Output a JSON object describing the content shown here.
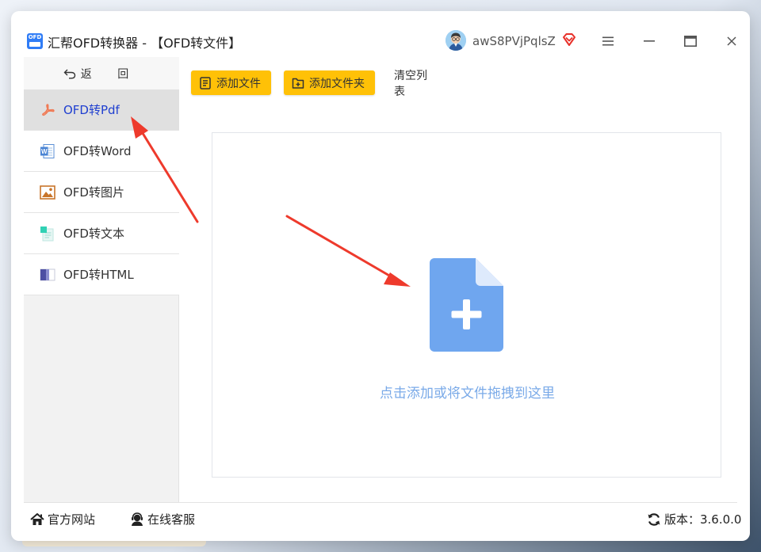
{
  "window": {
    "title": "汇帮OFD转换器 - 【OFD转文件】",
    "logo_text": "OFD",
    "username": "awS8PVjPqlsZ"
  },
  "sidebar": {
    "back_label": "返 回",
    "items": [
      {
        "label": "OFD转Pdf",
        "icon": "pdf-icon",
        "active": true
      },
      {
        "label": "OFD转Word",
        "icon": "word-icon",
        "active": false
      },
      {
        "label": "OFD转图片",
        "icon": "image-icon",
        "active": false
      },
      {
        "label": "OFD转文本",
        "icon": "text-icon",
        "active": false
      },
      {
        "label": "OFD转HTML",
        "icon": "html-icon",
        "active": false
      }
    ]
  },
  "toolbar": {
    "add_file": "添加文件",
    "add_folder": "添加文件夹",
    "clear_list": "清空列表"
  },
  "dropzone": {
    "hint": "点击添加或将文件拖拽到这里"
  },
  "footer": {
    "website": "官方网站",
    "service": "在线客服",
    "version": "版本：3.6.0.0"
  },
  "colors": {
    "accent_yellow": "#ffc107",
    "active_text": "#1f3fd0",
    "dropzone_icon": "#6fa6ef",
    "hint_text": "#7aaae8",
    "annotation_arrow": "#ee3a2c"
  }
}
